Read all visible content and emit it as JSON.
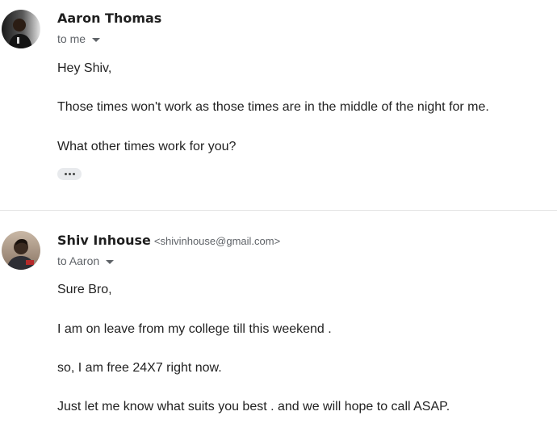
{
  "messages": [
    {
      "sender_name": "Aaron Thomas",
      "sender_email": "",
      "recipient": "to me",
      "avatar_icon": "person-avatar-icon",
      "body": [
        "Hey Shiv,",
        "Those times won't work as those times are in the middle of the night for me.",
        "What other times work for you?"
      ],
      "has_trimmed_content": true
    },
    {
      "sender_name": "Shiv Inhouse",
      "sender_email": "<shivinhouse@gmail.com>",
      "recipient": "to Aaron",
      "avatar_icon": "person-avatar-icon",
      "body": [
        "Sure Bro,",
        "I am on leave from my college till this weekend .",
        "so, I am free 24X7 right now.",
        "Just let me know what suits you best .  and we will hope to call ASAP."
      ],
      "has_trimmed_content": false
    }
  ],
  "colors": {
    "text_primary": "#202124",
    "text_secondary": "#5f6368",
    "divider": "#e6e6e6",
    "chip_background": "#e8eaed"
  }
}
